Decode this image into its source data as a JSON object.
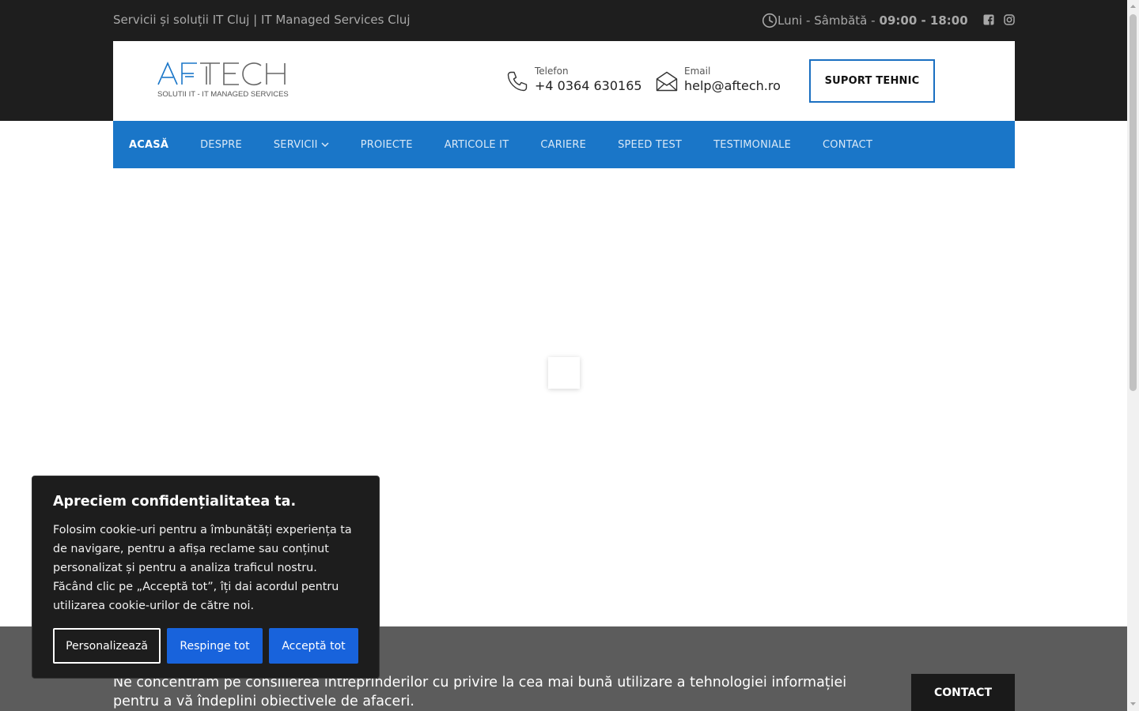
{
  "topbar": {
    "tagline": "Servicii și soluții IT Cluj | IT Managed Services Cluj",
    "hours_label": "Luni - Sâmbătă -",
    "hours_value": "09:00 - 18:00"
  },
  "header": {
    "logo_text": "AFTECH",
    "logo_subtitle": "SOLUTII IT - IT MANAGED SERVICES",
    "phone_label": "Telefon",
    "phone_value": "+4 0364 630165",
    "email_label": "Email",
    "email_value": "help@aftech.ro",
    "support_button": "SUPORT TEHNIC"
  },
  "nav": {
    "items": [
      {
        "label": "ACASĂ"
      },
      {
        "label": "DESPRE"
      },
      {
        "label": "SERVICII"
      },
      {
        "label": "PROIECTE"
      },
      {
        "label": "ARTICOLE IT"
      },
      {
        "label": "CARIERE"
      },
      {
        "label": "SPEED TEST"
      },
      {
        "label": "TESTIMONIALE"
      },
      {
        "label": "CONTACT"
      }
    ]
  },
  "footer": {
    "text": "Ne concentrăm pe consilierea întreprinderilor cu privire la cea mai bună utilizare a tehnologiei informației pentru a vă îndeplini obiectivele de afaceri.",
    "contact_button": "CONTACT"
  },
  "cookie": {
    "title": "Apreciem confidențialitatea ta.",
    "body": "Folosim cookie-uri pentru a îmbunătăți experiența ta de navigare, pentru a afișa reclame sau conținut personalizat și pentru a analiza traficul nostru. Făcând clic pe „Acceptă tot”, îți dai acordul pentru utilizarea cookie-urilor de către noi.",
    "customize": "Personalizează",
    "reject": "Respinge tot",
    "accept": "Acceptă tot"
  },
  "colors": {
    "nav_blue": "#1a76c8",
    "cookie_button_blue": "#1863dc",
    "dark_band": "#1e1e1e",
    "footer_band": "#5c5c5c"
  }
}
